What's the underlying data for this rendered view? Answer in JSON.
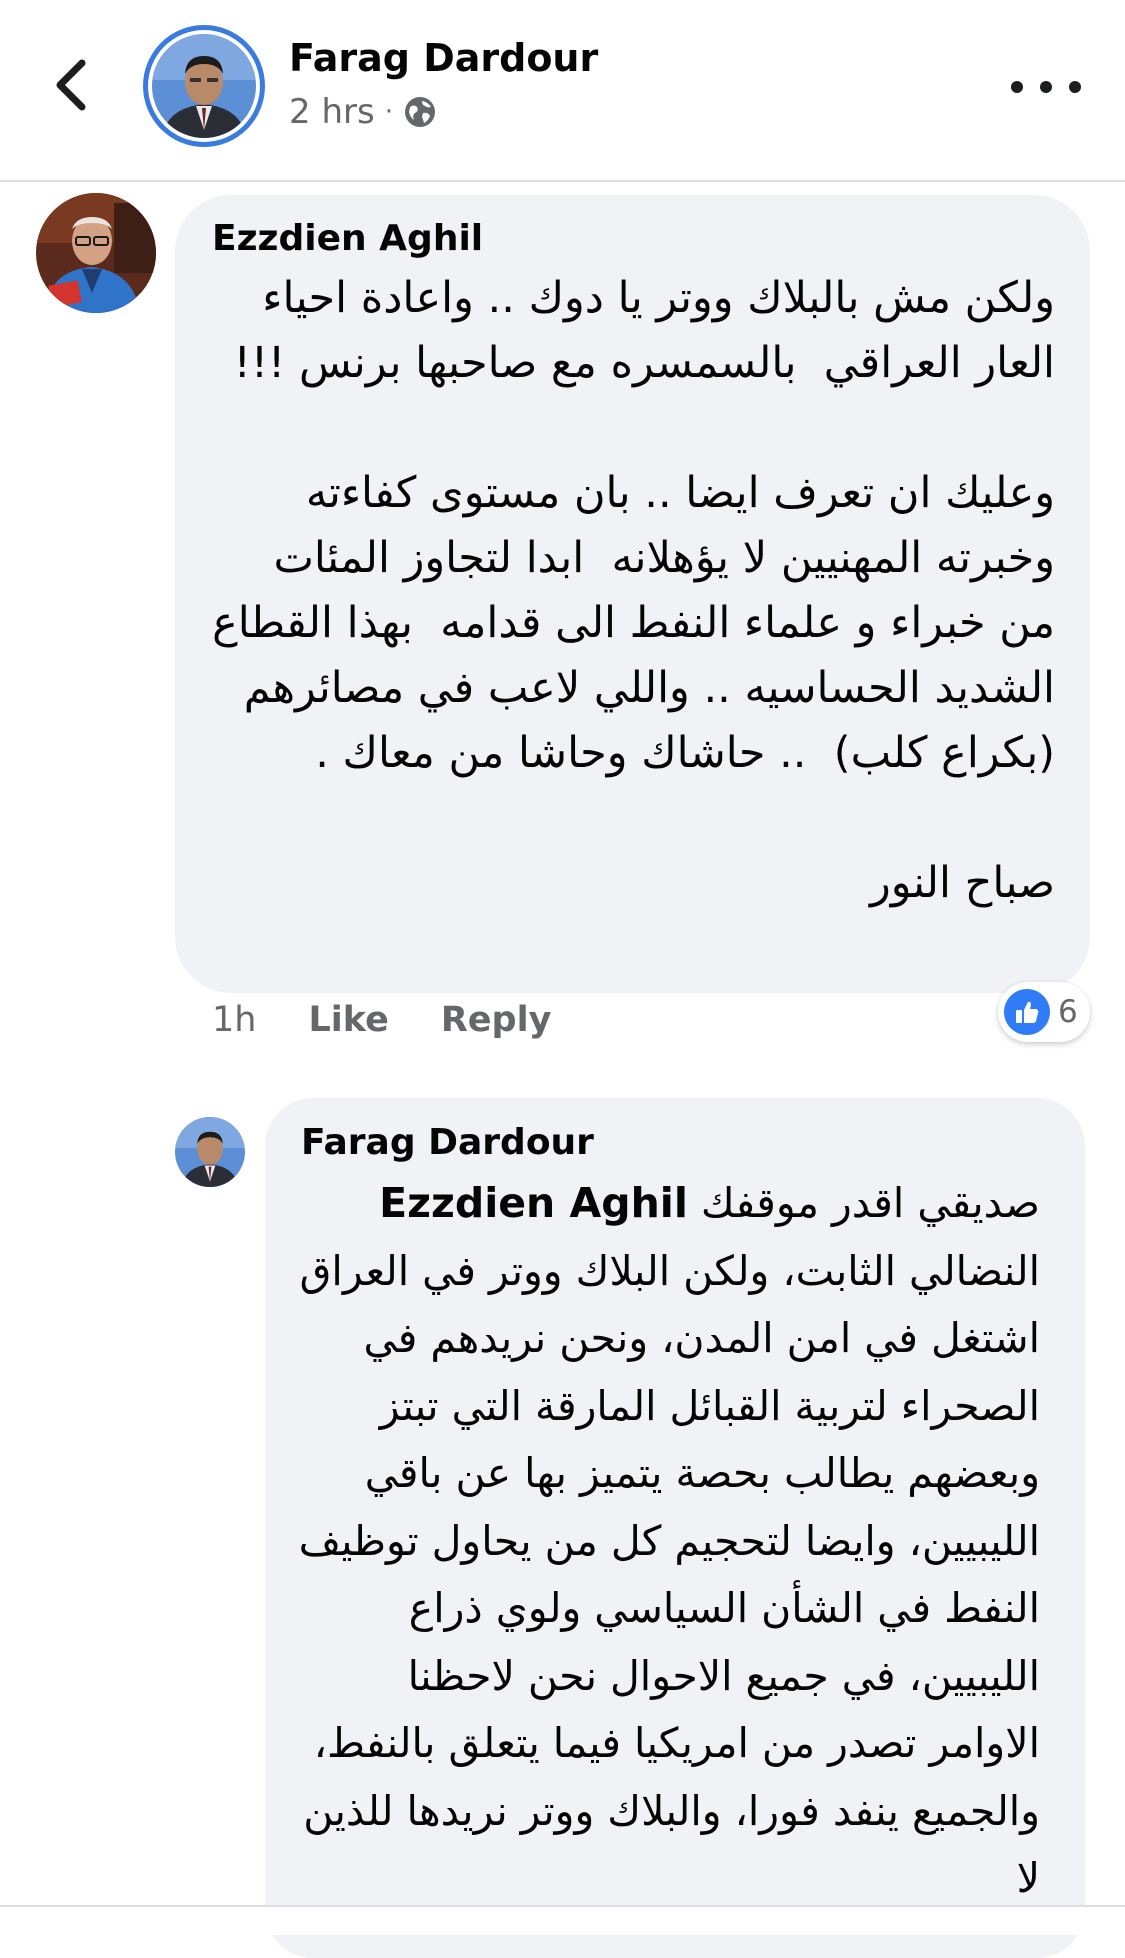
{
  "header": {
    "author_name": "Farag Dardour",
    "time": "2 hrs",
    "separator": "·",
    "back_icon": "chevron-left-icon",
    "privacy_icon": "globe-icon",
    "more_icon": "more-dots-icon"
  },
  "comment_1": {
    "author": "Ezzdien Aghil",
    "text": "ولكن مش بالبلاك ووتر يا دوك .. واعادة احياء العار العراقي  بالسمسره مع صاحبها برنس !!!\n\nوعليك ان تعرف ايضا .. بان مستوى كفاءته وخبرته المهنيين لا يؤهلانه  ابدا لتجاوز المئات من خبراء و علماء النفط الى قدامه  بهذا القطاع الشديد الحساسيه .. واللي لاعب في مصائرهم (بكراع كلب)  .. حاشاك وحاشا من معاك .\n\nصباح النور",
    "time": "1h",
    "like_label": "Like",
    "reply_label": "Reply",
    "reaction_count": "6",
    "reaction_icon": "thumbs-up-icon"
  },
  "comment_2": {
    "author": "Farag Dardour",
    "text_before_mention": "صديقي اقدر موقفك ",
    "mention": "Ezzdien Aghil",
    "text_after_mention": " النضالي الثابت، ولكن البلاك ووتر في العراق اشتغل في امن المدن، ونحن نريدهم في الصحراء لتربية القبائل المارقة التي تبتز وبعضهم يطالب بحصة يتميز بها عن باقي الليبيين، وايضا لتحجيم كل من يحاول توظيف النفط في الشأن السياسي ولوي ذراع الليبيين، في جميع الاحوال نحن لاحظنا الاوامر تصدر من امريكيا فيما يتعلق بالنفط، والجميع ينفد فورا، والبلاك ووتر نريدها للذين لا"
  },
  "colors": {
    "accent": "#3a7be0",
    "bubble": "#f0f2f5",
    "secondary_text": "#65676b"
  }
}
